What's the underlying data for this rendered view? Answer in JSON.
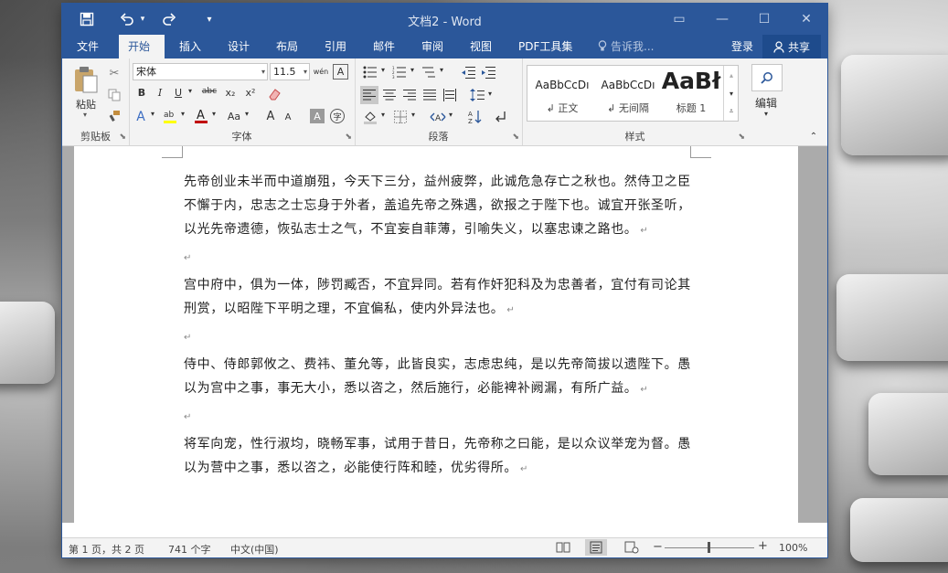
{
  "window": {
    "title": "文档2 - Word",
    "qat": {
      "save_icon": "save-icon",
      "undo_icon": "undo-icon",
      "redo_icon": "redo-icon",
      "customize": "▾"
    },
    "controls": {
      "ribbon_display": "▭",
      "minimize": "—",
      "maximize": "☐",
      "close": "✕"
    }
  },
  "tabs": [
    "文件",
    "开始",
    "插入",
    "设计",
    "布局",
    "引用",
    "邮件",
    "审阅",
    "视图",
    "PDF工具集"
  ],
  "active_tab": "开始",
  "tell_me": "告诉我...",
  "signin": "登录",
  "share": "共享",
  "ribbon": {
    "clipboard": {
      "label": "剪贴板",
      "paste": "粘贴"
    },
    "font": {
      "label": "字体",
      "font_name": "宋体",
      "font_size": "11.5",
      "wen_btn": "wén",
      "a_btn": "A",
      "bold": "B",
      "italic": "I",
      "underline": "U",
      "strike": "abc",
      "sub": "x₂",
      "sup": "x²",
      "aa": "Aa",
      "grow": "A",
      "shrink": "A"
    },
    "paragraph": {
      "label": "段落"
    },
    "styles": {
      "label": "样式",
      "items": [
        {
          "sample": "AaBbCcDı",
          "name": "↲ 正文"
        },
        {
          "sample": "AaBbCcDı",
          "name": "↲ 无间隔"
        },
        {
          "sample": "AaBł",
          "name": "标题 1"
        }
      ]
    },
    "editing": {
      "label": "编辑"
    }
  },
  "document": {
    "paragraphs": [
      "先帝创业未半而中道崩殂，今天下三分，益州疲弊，此诚危急存亡之秋也。然侍卫之臣不懈于内，忠志之士忘身于外者，盖追先帝之殊遇，欲报之于陛下也。诚宜开张圣听，以光先帝遗德，恢弘志士之气，不宜妄自菲薄，引喻失义，以塞忠谏之路也。",
      "宫中府中，俱为一体，陟罚臧否，不宜异同。若有作奸犯科及为忠善者，宜付有司论其刑赏，以昭陛下平明之理，不宜偏私，使内外异法也。",
      "侍中、侍郎郭攸之、费祎、董允等，此皆良实，志虑忠纯，是以先帝简拔以遗陛下。愚以为宫中之事，事无大小，悉以咨之，然后施行，必能裨补阙漏，有所广益。",
      "将军向宠，性行淑均，晓畅军事，试用于昔日，先帝称之曰能，是以众议举宠为督。愚以为营中之事，悉以咨之，必能使行阵和睦，优劣得所。"
    ],
    "para_mark": "↵"
  },
  "status": {
    "page": "第 1 页，共 2 页",
    "words": "741 个字",
    "language": "中文(中国)",
    "zoom": "100%",
    "zoom_minus": "−",
    "zoom_plus": "+"
  }
}
